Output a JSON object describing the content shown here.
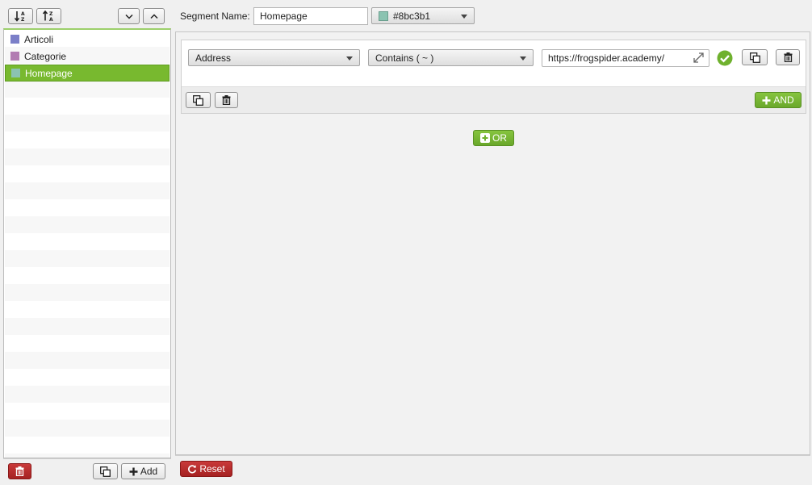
{
  "sidebar": {
    "segments": [
      {
        "label": "Articoli",
        "color": "#7b7fc8"
      },
      {
        "label": "Categorie",
        "color": "#b27cb2"
      },
      {
        "label": "Homepage",
        "color": "#8bc3b1",
        "selected": true
      }
    ],
    "footer": {
      "add_label": "Add"
    }
  },
  "header": {
    "segment_name_label": "Segment Name:",
    "segment_name_value": "Homepage",
    "color_value": "#8bc3b1"
  },
  "rule": {
    "field_value": "Address",
    "operator_value": "Contains ( ~ )",
    "url_value": "https://frogspider.academy/"
  },
  "buttons": {
    "and_label": "AND",
    "or_label": "OR",
    "reset_label": "Reset"
  },
  "colors": {
    "accent_green": "#78b92f",
    "danger_red": "#b22a2a",
    "valid_check": "#6fb12e"
  }
}
